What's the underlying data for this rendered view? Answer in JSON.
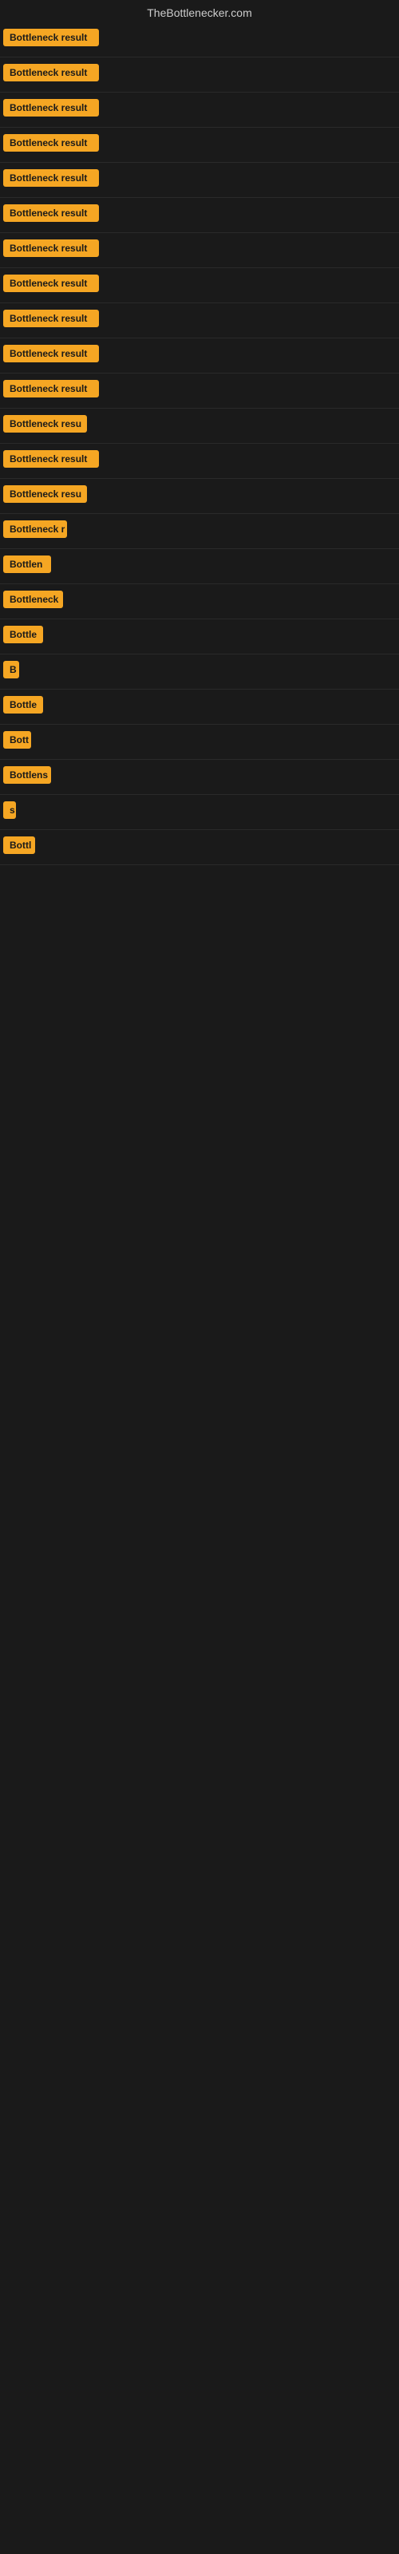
{
  "header": {
    "title": "TheBottlenecker.com"
  },
  "rows": [
    {
      "label": "Bottleneck result",
      "width": 120,
      "visible_text": "Bottleneck result"
    },
    {
      "label": "Bottleneck result",
      "width": 120,
      "visible_text": "Bottleneck result"
    },
    {
      "label": "Bottleneck result",
      "width": 120,
      "visible_text": "Bottleneck result"
    },
    {
      "label": "Bottleneck result",
      "width": 120,
      "visible_text": "Bottleneck result"
    },
    {
      "label": "Bottleneck result",
      "width": 120,
      "visible_text": "Bottleneck result"
    },
    {
      "label": "Bottleneck result",
      "width": 120,
      "visible_text": "Bottleneck result"
    },
    {
      "label": "Bottleneck result",
      "width": 120,
      "visible_text": "Bottleneck result"
    },
    {
      "label": "Bottleneck result",
      "width": 120,
      "visible_text": "Bottleneck result"
    },
    {
      "label": "Bottleneck result",
      "width": 120,
      "visible_text": "Bottleneck result"
    },
    {
      "label": "Bottleneck result",
      "width": 120,
      "visible_text": "Bottleneck result"
    },
    {
      "label": "Bottleneck result",
      "width": 120,
      "visible_text": "Bottleneck result"
    },
    {
      "label": "Bottleneck resu",
      "width": 105,
      "visible_text": "Bottleneck resu"
    },
    {
      "label": "Bottleneck result",
      "width": 120,
      "visible_text": "Bottleneck result"
    },
    {
      "label": "Bottleneck resu",
      "width": 105,
      "visible_text": "Bottleneck resu"
    },
    {
      "label": "Bottleneck r",
      "width": 80,
      "visible_text": "Bottleneck r"
    },
    {
      "label": "Bottlen",
      "width": 60,
      "visible_text": "Bottlen"
    },
    {
      "label": "Bottleneck",
      "width": 75,
      "visible_text": "Bottleneck"
    },
    {
      "label": "Bottle",
      "width": 50,
      "visible_text": "Bottle"
    },
    {
      "label": "B",
      "width": 20,
      "visible_text": "B"
    },
    {
      "label": "Bottle",
      "width": 50,
      "visible_text": "Bottle"
    },
    {
      "label": "Bott",
      "width": 35,
      "visible_text": "Bott"
    },
    {
      "label": "Bottlens",
      "width": 60,
      "visible_text": "Bottlens"
    },
    {
      "label": "s",
      "width": 12,
      "visible_text": "s"
    },
    {
      "label": "Bottl",
      "width": 40,
      "visible_text": "Bottl"
    }
  ],
  "badge_color": "#f5a623",
  "bg_color": "#1a1a1a",
  "header_color": "#cccccc"
}
